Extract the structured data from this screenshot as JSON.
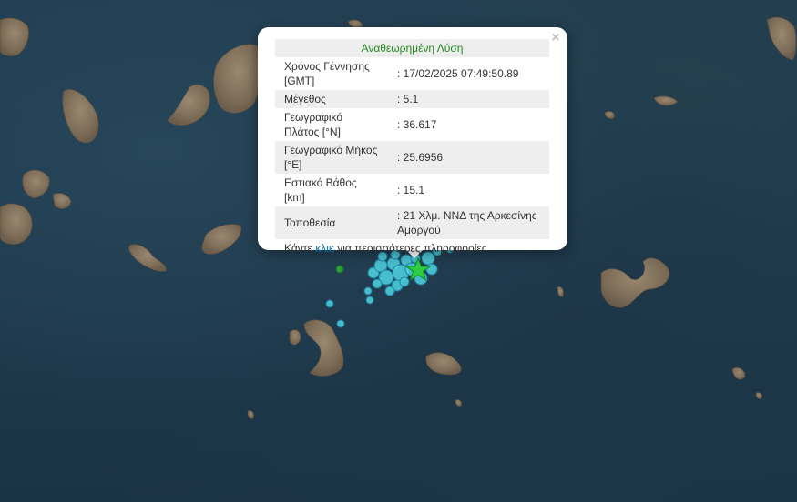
{
  "popup": {
    "title": "Αναθεωρημένη Λύση",
    "close_symbol": "×",
    "rows": [
      {
        "label": "Χρόνος Γέννησης [GMT]",
        "value": ": 17/02/2025 07:49:50.89"
      },
      {
        "label": "Μέγεθος",
        "value": ": 5.1"
      },
      {
        "label": "Γεωγραφικό Πλάτος [°N]",
        "value": ": 36.617"
      },
      {
        "label": "Γεωγραφικό Μήκος [°E]",
        "value": ": 25.6956"
      },
      {
        "label": "Εστιακό Βάθος [km]",
        "value": ": 15.1"
      },
      {
        "label": "Τοποθεσία",
        "value": ": 21 Χλμ. ΝΝΔ της Αρκεσίνης Αμοργού"
      }
    ],
    "more_prefix": "Κάντε ",
    "more_link": "κλικ",
    "more_suffix": " για περισσότερες πληροφορίες"
  },
  "map": {
    "sea_color": "#1f3a4c",
    "land_color": "#8a7863",
    "event_marker_color": "#4fd3e0",
    "main_event_star_color": "#2ecc40",
    "main_event_icon": "star-icon"
  }
}
